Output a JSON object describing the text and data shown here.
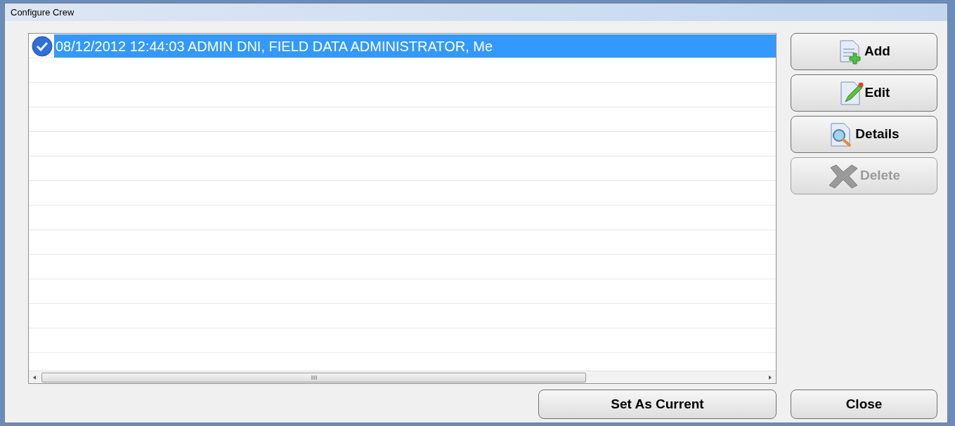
{
  "window": {
    "title": "Configure Crew"
  },
  "list": {
    "rows": [
      {
        "text": "08/12/2012 12:44:03  ADMIN DNI, FIELD DATA ADMINISTRATOR, Me",
        "checked": true,
        "selected": true
      }
    ]
  },
  "side_buttons": [
    {
      "label": "Add",
      "kind": "add",
      "disabled": false
    },
    {
      "label": "Edit",
      "kind": "edit",
      "disabled": false
    },
    {
      "label": "Details",
      "kind": "details",
      "disabled": false
    },
    {
      "label": "Delete",
      "kind": "delete",
      "disabled": true
    }
  ],
  "bottom_buttons": [
    {
      "label": "Set As Current"
    },
    {
      "label": "Close"
    }
  ]
}
